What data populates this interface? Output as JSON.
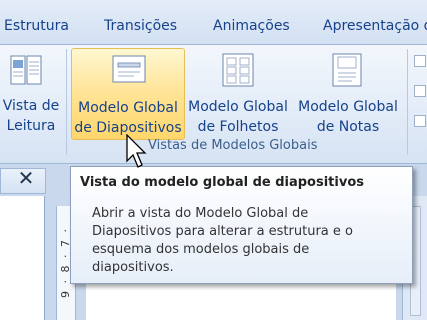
{
  "tabs": [
    "Estrutura",
    "Transições",
    "Animações",
    "Apresentação de"
  ],
  "ribbon": {
    "buttons": [
      {
        "line1": "Vista de",
        "line2": "Leitura",
        "icon": "reading-view-icon"
      },
      {
        "line1": "Modelo Global",
        "line2": "de Diapositivos",
        "icon": "slide-master-icon"
      },
      {
        "line1": "Modelo Global",
        "line2": "de Folhetos",
        "icon": "handout-master-icon"
      },
      {
        "line1": "Modelo Global",
        "line2": "de Notas",
        "icon": "notes-master-icon"
      }
    ],
    "group_label": "Vistas de Modelos Globais"
  },
  "panel": {
    "close_symbol": "✕"
  },
  "ruler": {
    "text": "9 · 8 · 7 ·"
  },
  "tooltip": {
    "title": "Vista do modelo global de diapositivos",
    "lines": [
      "Abrir a vista do Modelo Global de",
      "Diapositivos para alterar a estrutura e o",
      "esquema dos modelos globais de",
      "diapositivos."
    ]
  },
  "colors": {
    "accent": "#15428b",
    "highlight": "#ffe59a"
  }
}
